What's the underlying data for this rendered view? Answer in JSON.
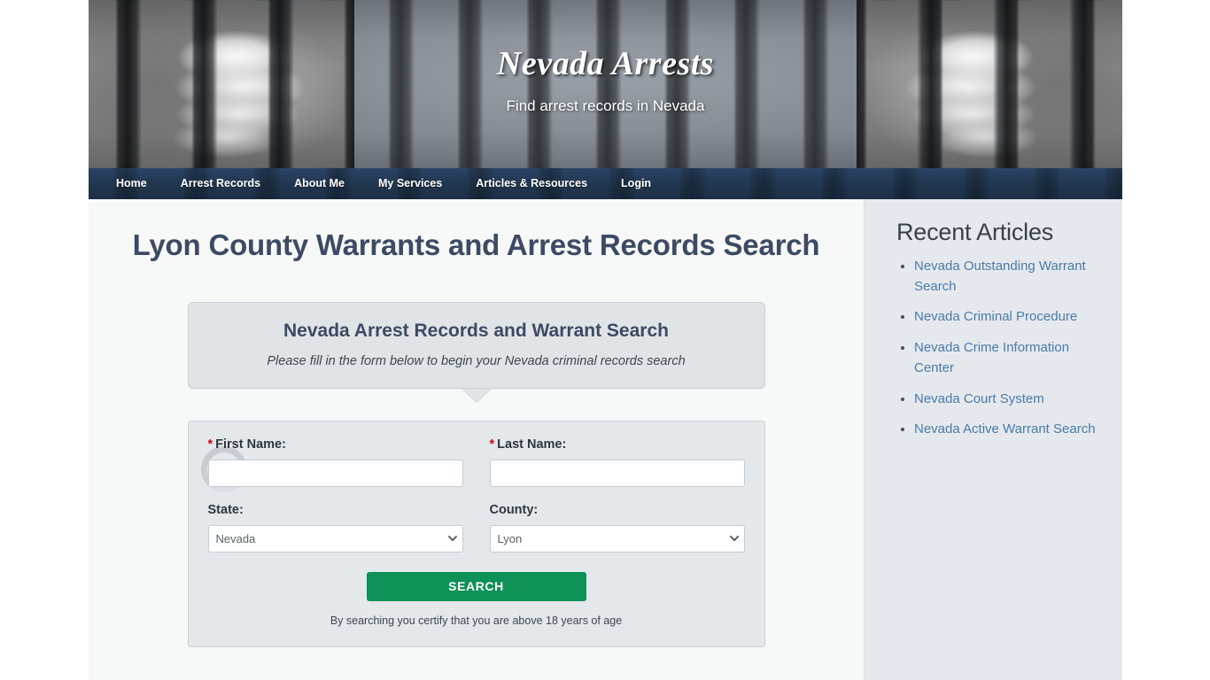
{
  "header": {
    "site_title": "Nevada Arrests",
    "tagline": "Find arrest records in Nevada",
    "banner_image": "prison-bars-hands-photo"
  },
  "nav": {
    "items": [
      {
        "label": "Home",
        "name": "nav-item-home"
      },
      {
        "label": "Arrest Records",
        "name": "nav-item-arrest-records"
      },
      {
        "label": "About Me",
        "name": "nav-item-about-me"
      },
      {
        "label": "My Services",
        "name": "nav-item-my-services"
      },
      {
        "label": "Articles & Resources",
        "name": "nav-item-articles-resources"
      },
      {
        "label": "Login",
        "name": "nav-item-login"
      }
    ]
  },
  "main": {
    "page_title": "Lyon County Warrants and Arrest Records Search",
    "callout": {
      "title": "Nevada Arrest Records and Warrant Search",
      "subtitle": "Please fill in the form below to begin your Nevada criminal records search"
    },
    "form": {
      "first_name": {
        "label": "First Name:",
        "required_mark": "*",
        "value": "",
        "placeholder": ""
      },
      "last_name": {
        "label": "Last Name:",
        "required_mark": "*",
        "value": "",
        "placeholder": ""
      },
      "state": {
        "label": "State:",
        "value": "Nevada",
        "options": [
          "Nevada"
        ]
      },
      "county": {
        "label": "County:",
        "value": "Lyon",
        "options": [
          "Lyon"
        ]
      },
      "search_button": "SEARCH",
      "disclaimer": "By searching you certify that you are above 18 years of age"
    }
  },
  "sidebar": {
    "title": "Recent Articles",
    "articles": [
      {
        "label": "Nevada Outstanding Warrant Search"
      },
      {
        "label": "Nevada Criminal Procedure"
      },
      {
        "label": "Nevada Crime Information Center"
      },
      {
        "label": "Nevada Court System"
      },
      {
        "label": "Nevada Active Warrant Search"
      }
    ]
  },
  "colors": {
    "nav_bg": "#22374f",
    "heading": "#3c4a63",
    "search_button": "#0d9157",
    "link": "#4a7aa8",
    "sidebar_bg": "#e5e9ee",
    "main_bg": "#f7f8f8",
    "required_star": "#d0021b"
  }
}
